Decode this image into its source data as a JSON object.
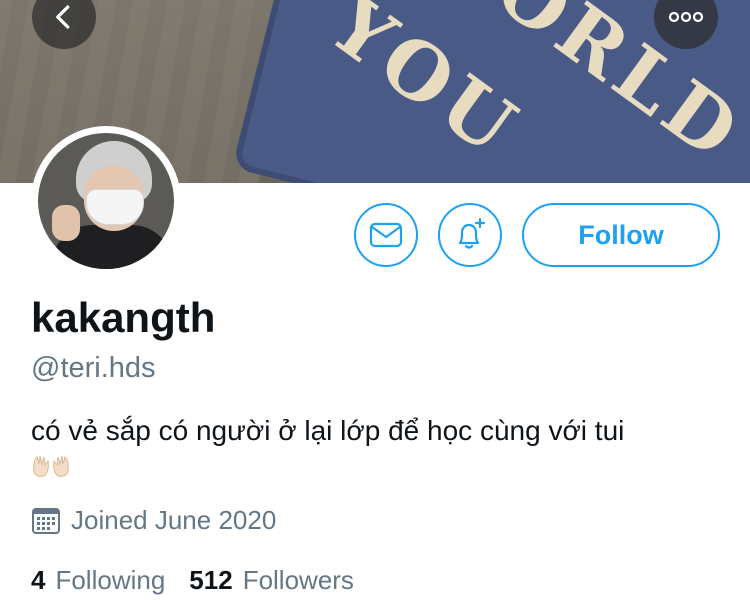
{
  "profile": {
    "display_name": "kakangth",
    "handle": "@teri.hds",
    "bio": "có vẻ sắp có người ở lại lớp để học cùng với tui",
    "bio_emoji": "raised-palms-emoji",
    "joined": "Joined June 2020",
    "following_count": "4",
    "following_label": "Following",
    "followers_count": "512",
    "followers_label": "Followers"
  },
  "actions": {
    "follow_label": "Follow",
    "message_icon": "mail-icon",
    "notify_icon": "bell-plus-icon"
  },
  "header": {
    "back_icon": "chevron-left-icon",
    "more_icon": "more-horizontal-icon",
    "banner_text": [
      "WORLD",
      "YOU"
    ]
  },
  "colors": {
    "accent": "#1da1f2",
    "secondary_text": "#657786",
    "primary_text": "#0f1419"
  }
}
